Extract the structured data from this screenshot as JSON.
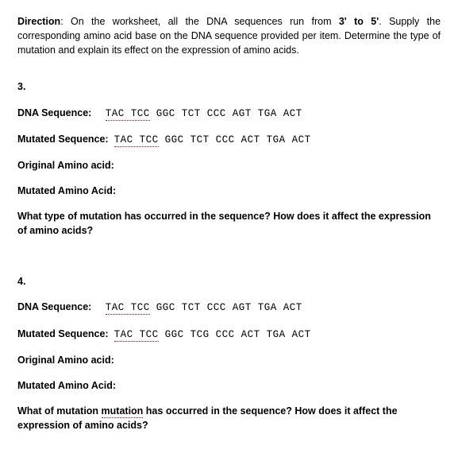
{
  "direction": {
    "label": "Direction",
    "text_before": ": On the worksheet, all the DNA sequences run from ",
    "run": "3' to 5'",
    "text_after": ". Supply the corresponding amino acid base on the DNA sequence provided per item.  Determine the type of mutation and explain its effect on the expression of amino acids."
  },
  "labels": {
    "dna_sequence": "DNA Sequence:",
    "mutated_sequence": "Mutated Sequence:",
    "original_amino": "Original Amino acid:",
    "mutated_amino": "Mutated Amino Acid:"
  },
  "q3": {
    "number": "3.",
    "dna_under": "TAC  TCC",
    "dna_rest": " GGC  TCT  CCC  AGT  TGA  ACT",
    "mut_under": "TAC  TCC",
    "mut_rest": " GGC  TCT  CCC  ACT  TGA  ACT",
    "question": "What type of mutation has occurred in the sequence? How does it affect the expression of amino acids?"
  },
  "q4": {
    "number": "4.",
    "dna_under": "TAC  TCC",
    "dna_rest": " GGC  TCT  CCC  AGT  TGA  ACT",
    "mut_under": "TAC  TCC",
    "mut_rest": " GGC  TCG  CCC  ACT  TGA  ACT",
    "question_before": "What of mutation ",
    "question_red": "mutation",
    "question_after": " has occurred in the sequence? How does it affect the expression of amino acids?"
  }
}
